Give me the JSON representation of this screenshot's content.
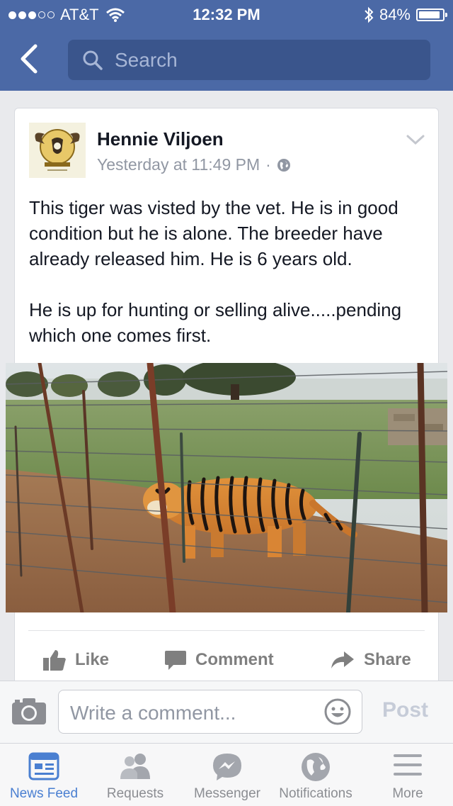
{
  "status_bar": {
    "carrier": "AT&T",
    "time": "12:32 PM",
    "battery": "84%",
    "icons": [
      "signal-dots",
      "wifi-icon",
      "bluetooth-icon",
      "battery-icon"
    ]
  },
  "nav": {
    "back_icon": "chevron-left-icon",
    "search_placeholder": "Search"
  },
  "post": {
    "author": "Hennie Viljoen",
    "timestamp": "Yesterday at 11:49 PM",
    "separator": "·",
    "audience_icon": "globe-icon",
    "paragraphs": [
      "This tiger was visted by the vet. He is in good condition but he is alone. The breeder have already released him. He is 6 years old.",
      "He is up for hunting or selling alive.....pending which one comes first."
    ],
    "actions": {
      "like": "Like",
      "comment": "Comment",
      "share": "Share"
    }
  },
  "comment_bar": {
    "placeholder": "Write a comment...",
    "post_label": "Post"
  },
  "tabbar": {
    "tabs": [
      {
        "label": "News Feed",
        "icon": "news-feed-icon",
        "active": true
      },
      {
        "label": "Requests",
        "icon": "requests-icon"
      },
      {
        "label": "Messenger",
        "icon": "messenger-icon"
      },
      {
        "label": "Notifications",
        "icon": "globe-icon"
      },
      {
        "label": "More",
        "icon": "menu-icon"
      }
    ]
  },
  "colors": {
    "brand_blue": "#4b69a6",
    "search_bg": "#3a558c",
    "active_tab": "#4a7fd1",
    "muted_text": "#9197a3"
  }
}
